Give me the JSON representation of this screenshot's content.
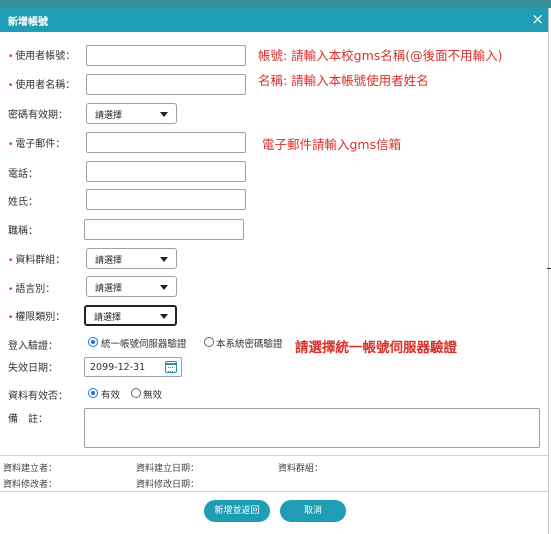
{
  "dialog": {
    "title": "新增帳號",
    "close_glyph": "×"
  },
  "fields": {
    "account": {
      "label": "使用者帳號：",
      "required": true,
      "value": "",
      "hint": "帳號: 請輸入本校gms名稱(@後面不用輸入)"
    },
    "name": {
      "label": "使用者名稱：",
      "required": true,
      "value": "",
      "hint": "名稱: 請輸入本帳號使用者姓名"
    },
    "password_expiry": {
      "label": "密碼有效期：",
      "selected": "請選擇"
    },
    "email": {
      "label": "電子郵件：",
      "required": true,
      "value": "",
      "hint": "電子郵件請輸入gms信箱"
    },
    "phone": {
      "label": "電話：",
      "value": ""
    },
    "surname": {
      "label": "姓氏：",
      "value": ""
    },
    "job_title": {
      "label": "職稱：",
      "value": ""
    },
    "data_group": {
      "label": "資料群組：",
      "required": true,
      "selected": "請選擇"
    },
    "language": {
      "label": "語言別：",
      "required": true,
      "selected": "請選擇"
    },
    "permission": {
      "label": "權限類別：",
      "required": true,
      "selected": "請選擇"
    },
    "login_auth": {
      "label": "登入驗證：",
      "options": [
        {
          "label": "統一帳號伺服器驗證",
          "checked": true
        },
        {
          "label": "本系統密碼驗證",
          "checked": false
        }
      ],
      "hint": "請選擇統一帳號伺服器驗證"
    },
    "expire_date": {
      "label": "失效日期：",
      "value": "2099-12-31"
    },
    "data_valid": {
      "label": "資料有效否：",
      "options": [
        {
          "label": "有效",
          "checked": true
        },
        {
          "label": "無效",
          "checked": false
        }
      ]
    },
    "remarks": {
      "label": "備　註：",
      "value": ""
    }
  },
  "meta": {
    "created_by": "資料建立者：",
    "created_date": "資料建立日期：",
    "group": "資料群組：",
    "modified_by": "資料修改者：",
    "modified_date": "資料修改日期："
  },
  "buttons": {
    "save_return": "新增並返回",
    "cancel": "取消"
  },
  "colors": {
    "header": "#1f9db5",
    "top_bar": "#3a8e97",
    "hint": "#d9302b",
    "radio": "#1a73e8"
  }
}
